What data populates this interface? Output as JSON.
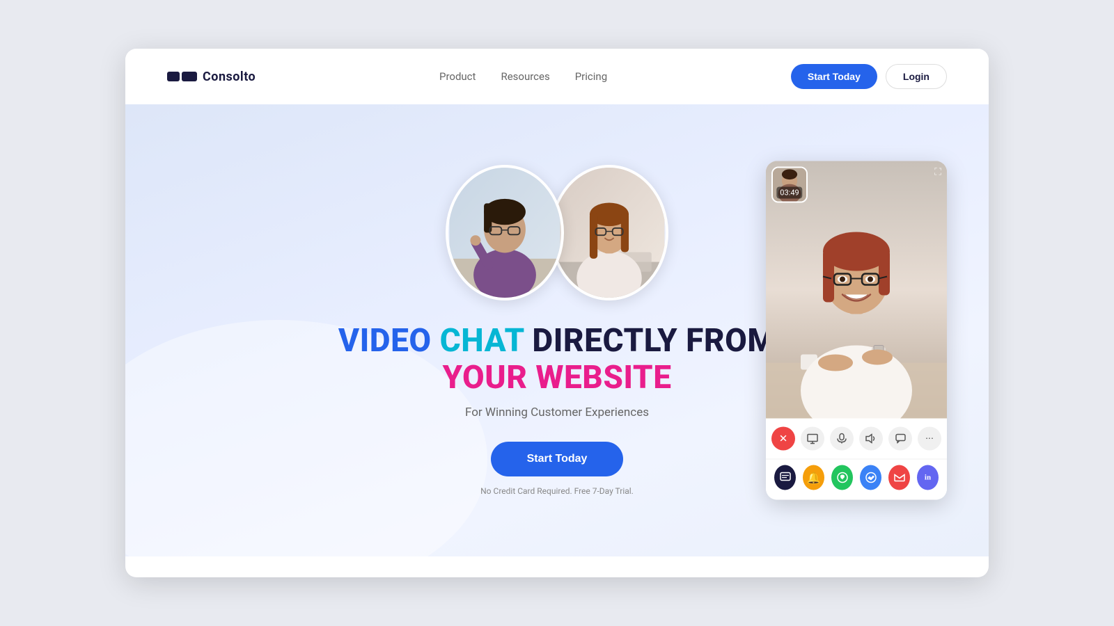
{
  "brand": {
    "name": "Consolto"
  },
  "nav": {
    "links": [
      {
        "label": "Product",
        "id": "product"
      },
      {
        "label": "Resources",
        "id": "resources"
      },
      {
        "label": "Pricing",
        "id": "pricing"
      }
    ],
    "start_label": "Start Today",
    "login_label": "Login"
  },
  "hero": {
    "headline_line1": "VIDEO CHAT DIRECTLY FROM",
    "headline_blue": "VIDEO ",
    "headline_cyan": "CHAT ",
    "headline_dark1": "DIRECTLY FROM",
    "headline_line2": "YOUR WEBSITE",
    "subheading": "For Winning Customer Experiences",
    "cta_label": "Start Today",
    "note": "No Credit Card Required. Free 7-Day Trial."
  },
  "video_widget": {
    "timer": "03:49",
    "controls": [
      {
        "icon": "✕",
        "type": "red",
        "label": "end-call"
      },
      {
        "icon": "⬛",
        "type": "gray",
        "label": "screen-share"
      },
      {
        "icon": "🎤",
        "type": "gray",
        "label": "mute"
      },
      {
        "icon": "🔊",
        "type": "gray",
        "label": "volume"
      },
      {
        "icon": "💬",
        "type": "gray",
        "label": "chat"
      },
      {
        "icon": "⋯",
        "type": "gray",
        "label": "more"
      }
    ],
    "social_buttons": [
      {
        "icon": "⬜",
        "type": "dark",
        "label": "chat-icon"
      },
      {
        "icon": "🔔",
        "type": "yellow",
        "label": "notification-icon"
      },
      {
        "icon": "📱",
        "type": "green",
        "label": "whatsapp-icon"
      },
      {
        "icon": "💬",
        "type": "blue-fb",
        "label": "messenger-icon"
      },
      {
        "icon": "✉",
        "type": "red-g",
        "label": "gmail-icon"
      },
      {
        "icon": "in",
        "type": "blue-in",
        "label": "linkedin-icon"
      }
    ]
  },
  "colors": {
    "blue": "#2563eb",
    "cyan": "#06b6d4",
    "pink": "#e91e8c",
    "dark": "#1a1a40"
  }
}
